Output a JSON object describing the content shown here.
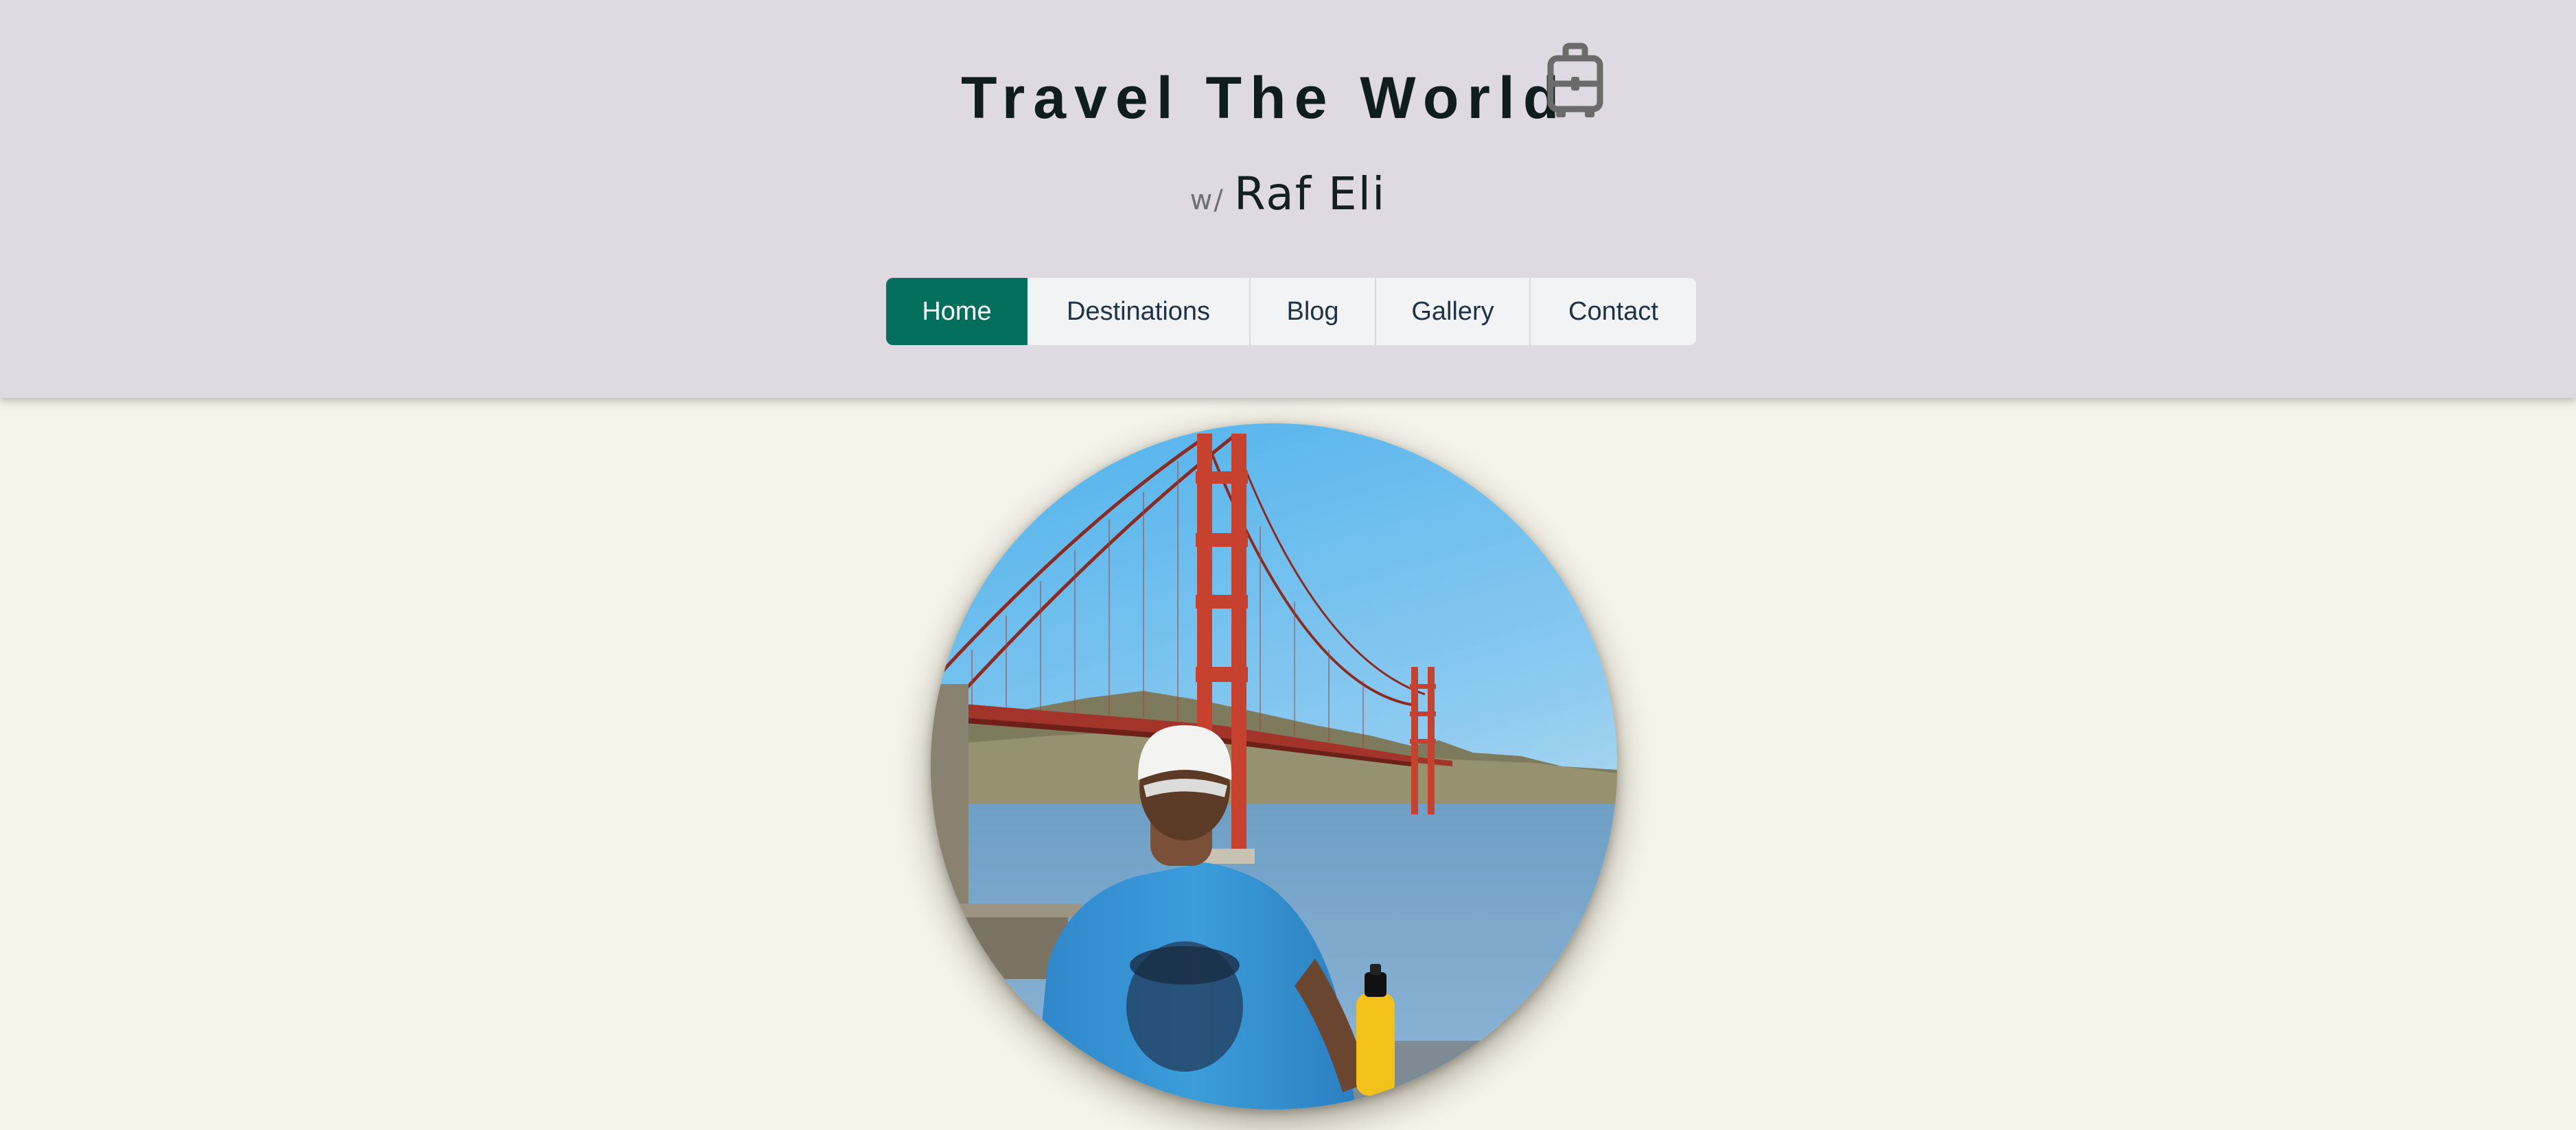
{
  "header": {
    "title": "Travel The World",
    "title_icon": "luggage-icon",
    "subtitle_prefix": "w/",
    "author": "Raf Eli"
  },
  "nav": {
    "items": [
      {
        "label": "Home",
        "active": true
      },
      {
        "label": "Destinations",
        "active": false
      },
      {
        "label": "Blog",
        "active": false
      },
      {
        "label": "Gallery",
        "active": false
      },
      {
        "label": "Contact",
        "active": false
      }
    ]
  },
  "hero": {
    "image_subject": "person in white cap and blue t-shirt facing the Golden Gate Bridge, holding a yellow bottle"
  },
  "colors": {
    "header_bg": "#dfd9e2",
    "page_bg": "#f5f3ea",
    "accent": "#036f5c",
    "title_text": "#0f1d1c",
    "nav_text": "#1e3146",
    "icon": "#6b6b6b"
  }
}
